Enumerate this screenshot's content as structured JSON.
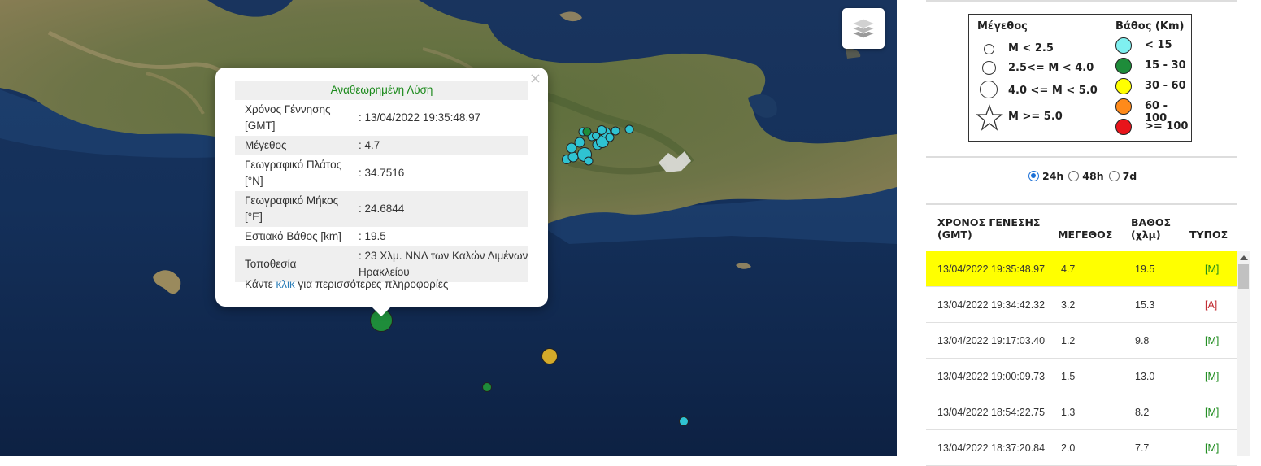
{
  "map": {
    "layers_icon": "layers-icon",
    "quakes": [
      {
        "depth_class": "15 - 30",
        "color": "#1e8c3a",
        "size": "large"
      },
      {
        "depth_class": "30 - 60",
        "color": "#d4aa2a",
        "size": "medium"
      },
      {
        "depth_class": "15 - 30",
        "color": "#1e8c3a",
        "size": "small"
      },
      {
        "depth_class": "< 15",
        "color": "#2fc3d2",
        "size": "small"
      }
    ]
  },
  "popup": {
    "title": "Αναθεωρημένη Λύση",
    "close": "×",
    "rows": [
      {
        "label": "Χρόνος Γέννησης [GMT]",
        "value": ": 13/04/2022 19:35:48.97"
      },
      {
        "label": "Μέγεθος",
        "value": ": 4.7"
      },
      {
        "label": "Γεωγραφικό Πλάτος [°N]",
        "value": ": 34.7516"
      },
      {
        "label": "Γεωγραφικό Μήκος [°E]",
        "value": ": 24.6844"
      },
      {
        "label": "Εστιακό Βάθος [km]",
        "value": ": 19.5"
      },
      {
        "label": "Τοποθεσία",
        "value": ": 23 Χλμ. ΝΝΔ των Καλών Λιμένων Ηρακλείου"
      }
    ],
    "more_prefix": "Κάντε",
    "more_link": "κλικ",
    "more_suffix": "για περισσότερες πληροφορίες"
  },
  "legend": {
    "magnitude_title": "Μέγεθος",
    "depth_title": "Βάθος (Km)",
    "magnitudes": [
      "M < 2.5",
      "2.5<= M < 4.0",
      "4.0 <= M < 5.0",
      "M >= 5.0"
    ],
    "depths": [
      {
        "label": "< 15",
        "color": "#7ff0f0"
      },
      {
        "label": "15 - 30",
        "color": "#1e8c3a"
      },
      {
        "label": "30 - 60",
        "color": "#ffff00"
      },
      {
        "label": "60 - 100",
        "color": "#ff8a1a"
      },
      {
        "label": ">= 100",
        "color": "#e8141b"
      }
    ]
  },
  "filters": [
    {
      "label": "24h",
      "selected": true
    },
    {
      "label": "48h",
      "selected": false
    },
    {
      "label": "7d",
      "selected": false
    }
  ],
  "table": {
    "headers": {
      "time_l1": "ΧΡΟΝΟΣ ΓΕΝΕΣΗΣ",
      "time_l2": "(GMT)",
      "magnitude": "ΜΕΓΕΘΟΣ",
      "depth_l1": "ΒΑΘΟΣ",
      "depth_l2": "(χλμ)",
      "type": "ΤΥΠΟΣ"
    },
    "rows": [
      {
        "time": "13/04/2022 19:35:48.97",
        "mag": "4.7",
        "depth": "19.5",
        "type": "[M]"
      },
      {
        "time": "13/04/2022 19:34:42.32",
        "mag": "3.2",
        "depth": "15.3",
        "type": "[A]"
      },
      {
        "time": "13/04/2022 19:17:03.40",
        "mag": "1.2",
        "depth": "9.8",
        "type": "[M]"
      },
      {
        "time": "13/04/2022 19:00:09.73",
        "mag": "1.5",
        "depth": "13.0",
        "type": "[M]"
      },
      {
        "time": "13/04/2022 18:54:22.75",
        "mag": "1.3",
        "depth": "8.2",
        "type": "[M]"
      },
      {
        "time": "13/04/2022 18:37:20.84",
        "mag": "2.0",
        "depth": "7.7",
        "type": "[M]"
      }
    ]
  }
}
